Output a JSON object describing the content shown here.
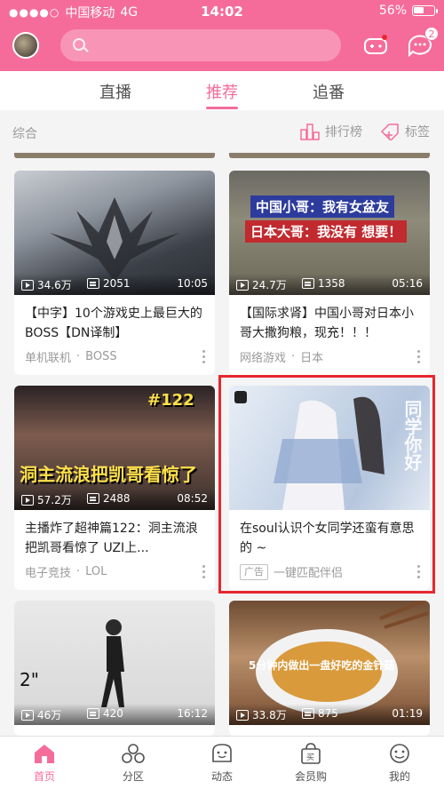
{
  "status_bar": {
    "carrier": "中国移动",
    "network": "4G",
    "time": "14:02",
    "battery": "56%",
    "battery_level": 0.56
  },
  "header": {
    "search_placeholder": "",
    "message_badge": "2",
    "icons": [
      "avatar",
      "game-center-icon",
      "message-icon"
    ]
  },
  "tabs": [
    {
      "label": "直播",
      "active": false
    },
    {
      "label": "推荐",
      "active": true
    },
    {
      "label": "追番",
      "active": false
    }
  ],
  "subbar": {
    "category": "综合",
    "rank_label": "排行榜",
    "tags_label": "标签"
  },
  "cards": [
    {
      "views": "34.6万",
      "comments": "2051",
      "duration": "10:05",
      "title": "【中字】10个游戏史上最巨大的BOSS【DN译制】",
      "meta": [
        "单机联机",
        "BOSS"
      ],
      "overlay": ""
    },
    {
      "views": "24.7万",
      "comments": "1358",
      "duration": "05:16",
      "title": "【国际求肾】中国小哥对日本小哥大撒狗粮，现充！！！",
      "meta": [
        "网络游戏",
        "日本"
      ],
      "overlay": "中国小哥：我有女盆友",
      "overlay2": "日本大哥：我没有 想要！"
    },
    {
      "views": "57.2万",
      "comments": "2488",
      "duration": "08:52",
      "title": "主播炸了超神篇122：洞主流浪把凯哥看惊了 UZI上...",
      "meta": [
        "电子竞技",
        "LOL"
      ],
      "overlay": "洞主流浪把凯哥看惊了",
      "overlay2": "#122"
    },
    {
      "title": "在soul认识个女同学还蛮有意思的 ~",
      "ad_label": "广告",
      "ad_text": "一键匹配伴侣",
      "overlay": "同学你好"
    },
    {
      "views": "46万",
      "comments": "420",
      "duration": "16:12"
    },
    {
      "views": "33.8万",
      "comments": "875",
      "duration": "01:19",
      "overlay": "5分钟内做出一盘好吃的金针菇"
    }
  ],
  "bottom_nav": [
    {
      "label": "首页",
      "icon": "home-icon",
      "active": true
    },
    {
      "label": "分区",
      "icon": "category-icon",
      "active": false
    },
    {
      "label": "动态",
      "icon": "feed-icon",
      "active": false
    },
    {
      "label": "会员购",
      "icon": "shop-icon",
      "active": false
    },
    {
      "label": "我的",
      "icon": "profile-icon",
      "active": false
    }
  ],
  "colors": {
    "brand_pink": "#f56c9a",
    "highlight_red": "#e8262f"
  }
}
